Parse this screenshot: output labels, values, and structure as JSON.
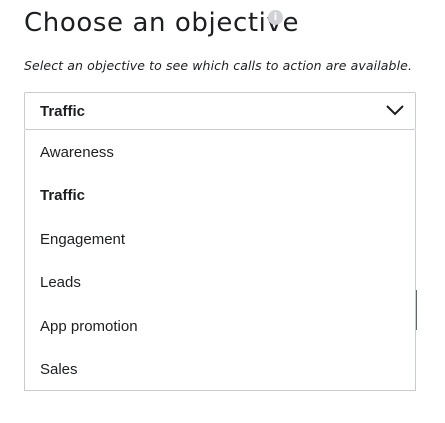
{
  "header": {
    "title": "Choose an objective",
    "info_icon": "info-icon",
    "subtitle": "Select an objective to see which calls to action are available."
  },
  "objective_select": {
    "value": "Traffic",
    "chevron_icon": "chevron-down-icon"
  },
  "dropdown": {
    "options": [
      {
        "label": "Awareness",
        "selected": false
      },
      {
        "label": "Traffic",
        "selected": true
      },
      {
        "label": "Engagement",
        "selected": false
      },
      {
        "label": "Leads",
        "selected": false
      },
      {
        "label": "App promotion",
        "selected": false
      },
      {
        "label": "Sales",
        "selected": false
      }
    ]
  }
}
